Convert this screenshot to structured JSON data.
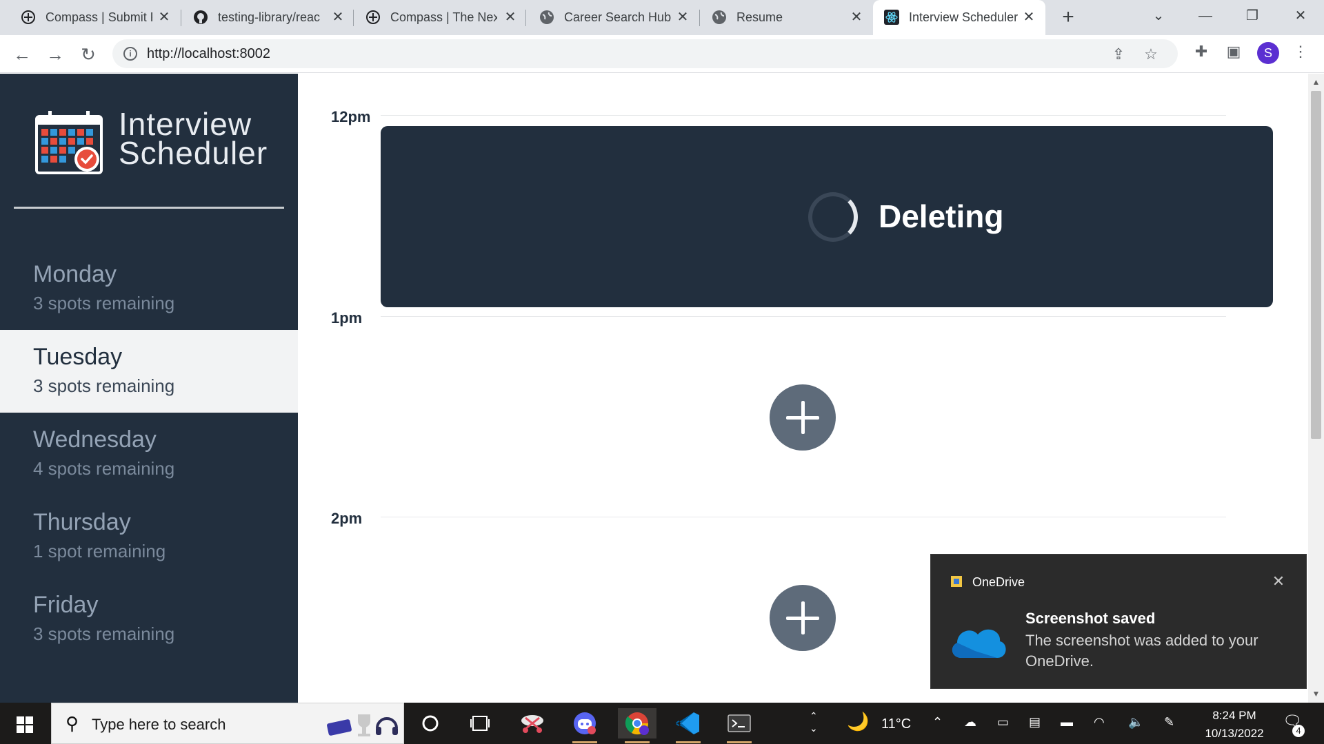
{
  "browser": {
    "tabs": [
      {
        "title": "Compass | Submit F",
        "icon": "compass-icon"
      },
      {
        "title": "testing-library/reac",
        "icon": "github-icon"
      },
      {
        "title": "Compass | The Nex",
        "icon": "compass-icon"
      },
      {
        "title": "Career Search Hub:",
        "icon": "globe-icon"
      },
      {
        "title": "Resume",
        "icon": "globe-icon"
      },
      {
        "title": "Interview Scheduler",
        "icon": "react-icon",
        "active": true
      }
    ],
    "url": "http://localhost:8002",
    "profile_initial": "S"
  },
  "app": {
    "brand_line1": "Interview",
    "brand_line2": "Scheduler",
    "days": [
      {
        "name": "Monday",
        "spots": "3 spots remaining"
      },
      {
        "name": "Tuesday",
        "spots": "3 spots remaining",
        "selected": true
      },
      {
        "name": "Wednesday",
        "spots": "4 spots remaining"
      },
      {
        "name": "Thursday",
        "spots": "1 spot remaining"
      },
      {
        "name": "Friday",
        "spots": "3 spots remaining"
      }
    ],
    "times": [
      "12pm",
      "1pm",
      "2pm"
    ],
    "status_message": "Deleting",
    "colors": {
      "sidebar": "#222f3e",
      "selected_day": "#f2f3f4",
      "add_button": "#5e6b7a"
    }
  },
  "toast": {
    "app_name": "OneDrive",
    "title": "Screenshot saved",
    "body": "The screenshot was added to your OneDrive."
  },
  "taskbar": {
    "search_placeholder": "Type here to search",
    "temperature": "11°C",
    "time": "8:24 PM",
    "date": "10/13/2022",
    "notification_count": "4"
  }
}
